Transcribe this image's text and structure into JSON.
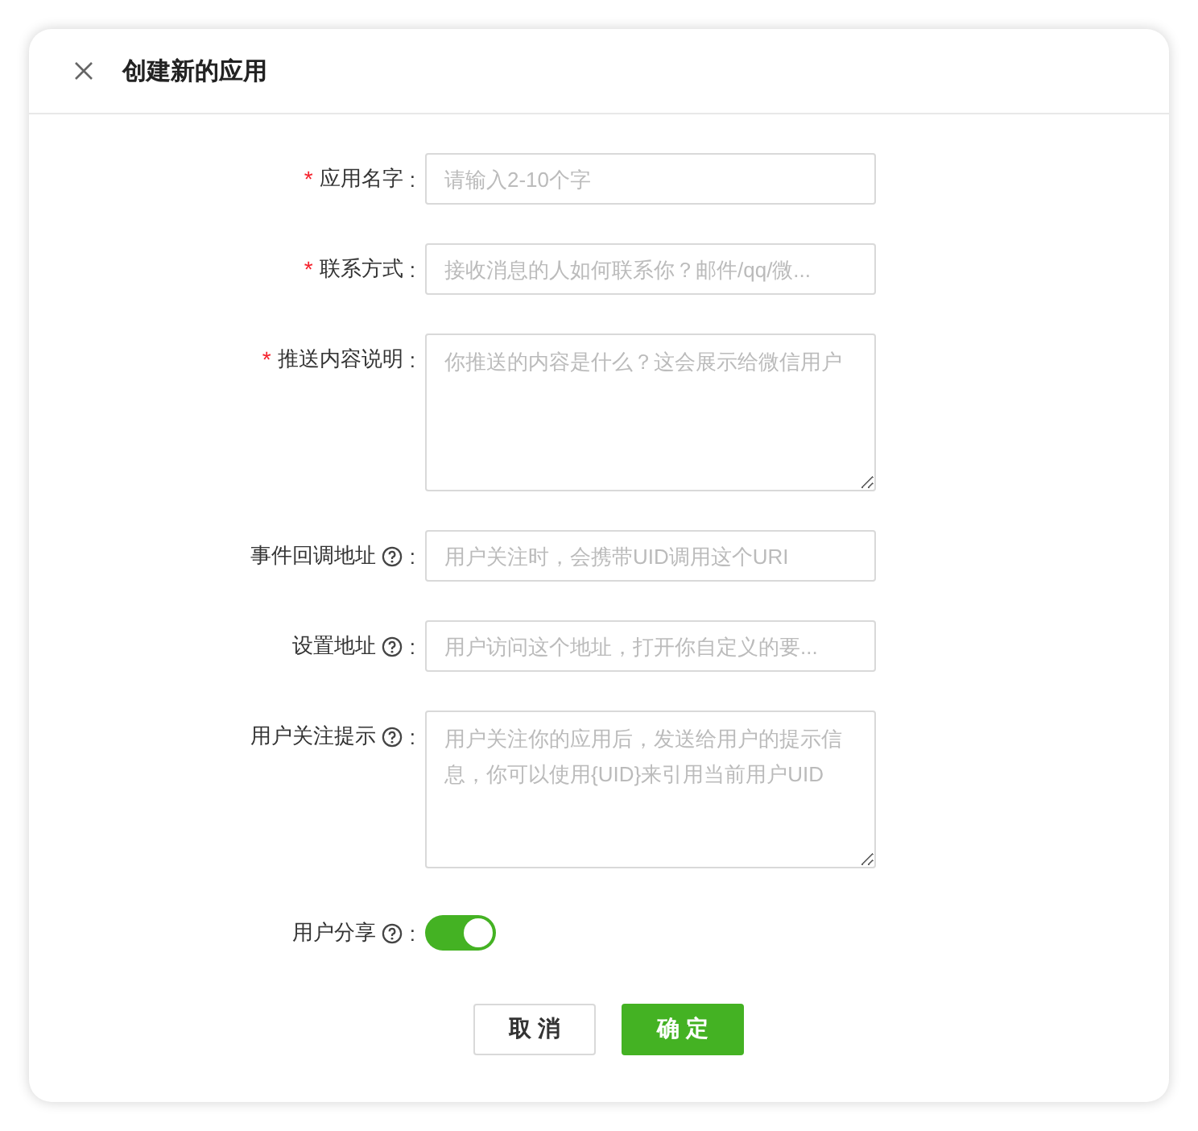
{
  "dialog": {
    "title": "创建新的应用"
  },
  "fields": [
    {
      "kind": "input",
      "mark": "*",
      "label": "应用名字",
      "help": false,
      "colon": ":",
      "placeholder": "请输入2-10个字"
    },
    {
      "kind": "input",
      "mark": "*",
      "label": "联系方式",
      "help": false,
      "colon": ":",
      "placeholder": "接收消息的人如何联系你？邮件/qq/微..."
    },
    {
      "kind": "textarea",
      "mark": "*",
      "label": "推送内容说明",
      "help": false,
      "colon": ":",
      "placeholder": "你推送的内容是什么？这会展示给微信用户"
    },
    {
      "kind": "input",
      "label": "事件回调地址",
      "help": true,
      "colon": ":",
      "placeholder": "用户关注时，会携带UID调用这个URI"
    },
    {
      "kind": "input",
      "label": "设置地址",
      "help": true,
      "colon": ":",
      "placeholder": "用户访问这个地址，打开你自定义的要..."
    },
    {
      "kind": "textarea",
      "label": "用户关注提示",
      "help": true,
      "colon": ":",
      "placeholder": "用户关注你的应用后，发送给用户的提示信息，你可以使用{UID}来引用当前用户UID"
    },
    {
      "kind": "switch",
      "label": "用户分享",
      "help": true,
      "colon": ":",
      "on": true
    }
  ],
  "buttons": [
    {
      "label": "取 消",
      "kind": "secondary"
    },
    {
      "label": "确 定",
      "kind": "primary"
    }
  ]
}
